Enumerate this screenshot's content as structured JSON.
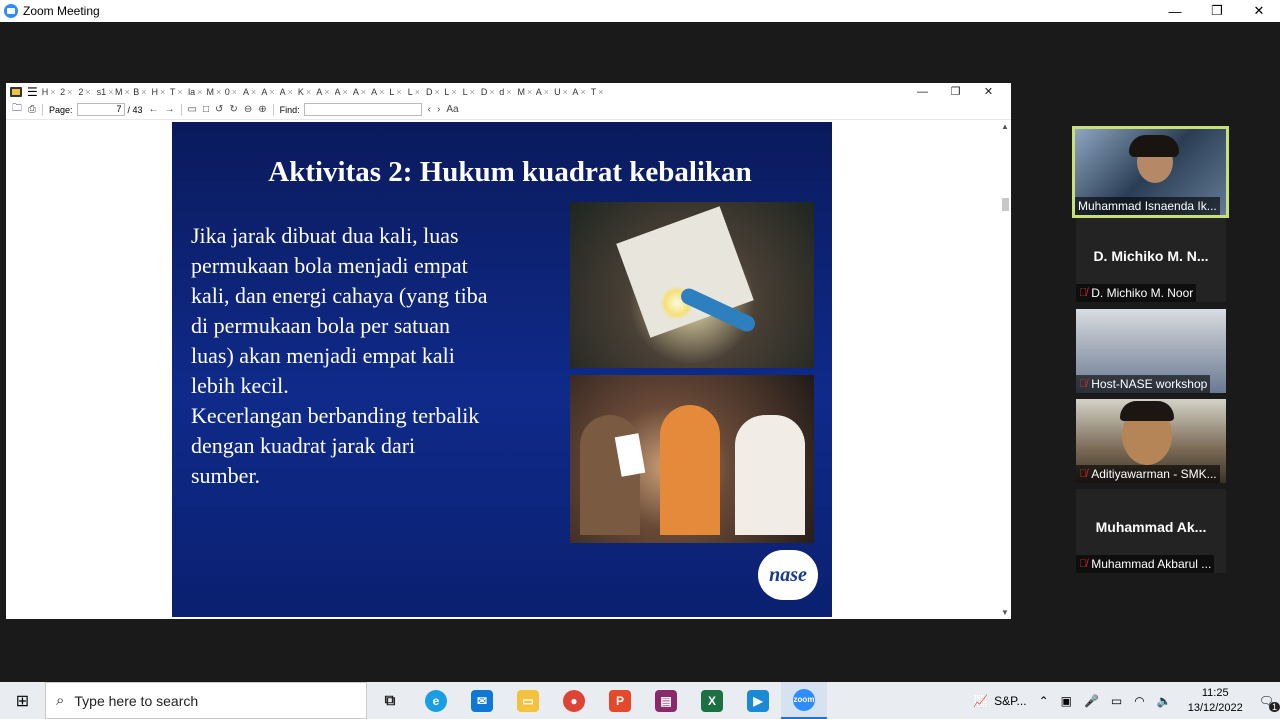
{
  "window": {
    "title": "Zoom Meeting",
    "minimize": "—",
    "restore": "❐",
    "close": "✕"
  },
  "pdf_viewer": {
    "tabs": [
      "H",
      "2",
      "2",
      "s1",
      "M",
      "B",
      "H",
      "T",
      "la",
      "M",
      "0",
      "A",
      "A",
      "A",
      "K",
      "A",
      "A",
      "A",
      "A",
      "L",
      "L",
      "D",
      "L",
      "L",
      "D",
      "d",
      "M",
      "A",
      "U",
      "A",
      "T"
    ],
    "toolbar": {
      "page_label": "Page:",
      "page_current": "7",
      "page_total": "/ 43",
      "find_label": "Find:",
      "aa_label": "Aa"
    }
  },
  "slide": {
    "title": "Aktivitas 2: Hukum kuadrat kebalikan",
    "body_lines": [
      "Jika jarak dibuat dua kali, luas",
      "permukaan bola menjadi empat",
      "kali, dan energi cahaya (yang tiba",
      "di permukaan bola per satuan",
      "luas) akan menjadi empat kali",
      "lebih kecil.",
      "Kecerlangan berbanding terbalik",
      "dengan kuadrat jarak dari",
      "sumber."
    ],
    "logo_text": "nase"
  },
  "participants": [
    {
      "name": "Muhammad Isnaenda Ik...",
      "big_name": "",
      "muted": false,
      "video": true
    },
    {
      "name": "D. Michiko M. Noor",
      "big_name": "D. Michiko M. N...",
      "muted": true,
      "video": false
    },
    {
      "name": "Host-NASE workshop",
      "big_name": "",
      "muted": true,
      "video": true
    },
    {
      "name": "Aditiyawarman - SMK...",
      "big_name": "",
      "muted": true,
      "video": true
    },
    {
      "name": "Muhammad Akbarul ...",
      "big_name": "Muhammad Ak...",
      "muted": true,
      "video": false
    }
  ],
  "taskbar": {
    "search_placeholder": "Type here to search",
    "stock": "S&P...",
    "time": "11:25",
    "date": "13/12/2022",
    "notification_count": "1"
  },
  "colors": {
    "slide_bg": "#0f2a8a",
    "active_speaker_border": "#c8e07a",
    "zoom_blue": "#2d8cff"
  }
}
